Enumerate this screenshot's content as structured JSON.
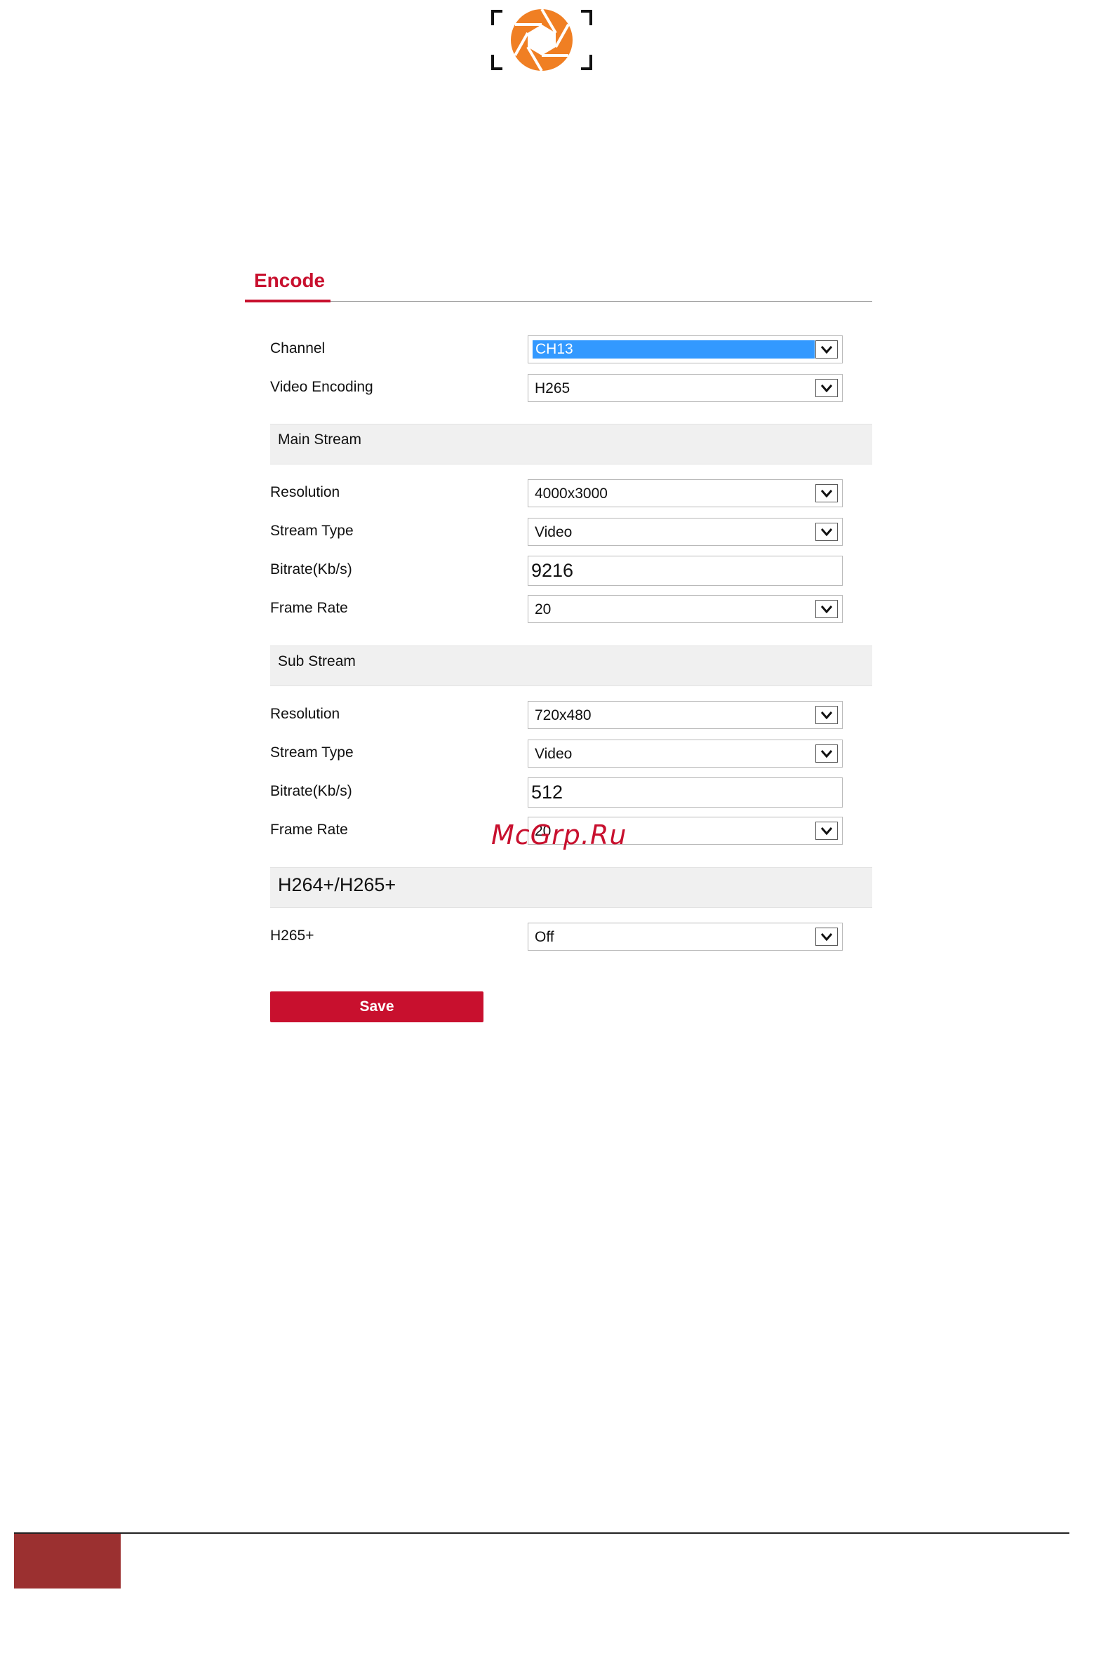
{
  "page": {
    "tab_title": "Encode",
    "watermark": "McGrp.Ru"
  },
  "form": {
    "channel": {
      "label": "Channel",
      "value": "CH13"
    },
    "video_encoding": {
      "label": "Video Encoding",
      "value": "H265"
    },
    "main_stream": {
      "title": "Main Stream",
      "resolution": {
        "label": "Resolution",
        "value": "4000x3000"
      },
      "stream_type": {
        "label": "Stream Type",
        "value": "Video"
      },
      "bitrate": {
        "label": "Bitrate(Kb/s)",
        "value": "9216"
      },
      "frame_rate": {
        "label": "Frame Rate",
        "value": "20"
      }
    },
    "sub_stream": {
      "title": "Sub Stream",
      "resolution": {
        "label": "Resolution",
        "value": "720x480"
      },
      "stream_type": {
        "label": "Stream Type",
        "value": "Video"
      },
      "bitrate": {
        "label": "Bitrate(Kb/s)",
        "value": "512"
      },
      "frame_rate": {
        "label": "Frame Rate",
        "value": "20"
      }
    },
    "h264_h265_plus": {
      "title": "H264+/H265+",
      "h265_plus": {
        "label": "H265+",
        "value": "Off"
      }
    },
    "save_label": "Save"
  },
  "colors": {
    "accent": "#c8102e",
    "logo_orange": "#f07f23",
    "selection_blue": "#3399ff",
    "footer_block": "#9b3030"
  },
  "icons": {
    "logo": "aperture-logo-icon",
    "dropdown": "chevron-down-icon"
  }
}
